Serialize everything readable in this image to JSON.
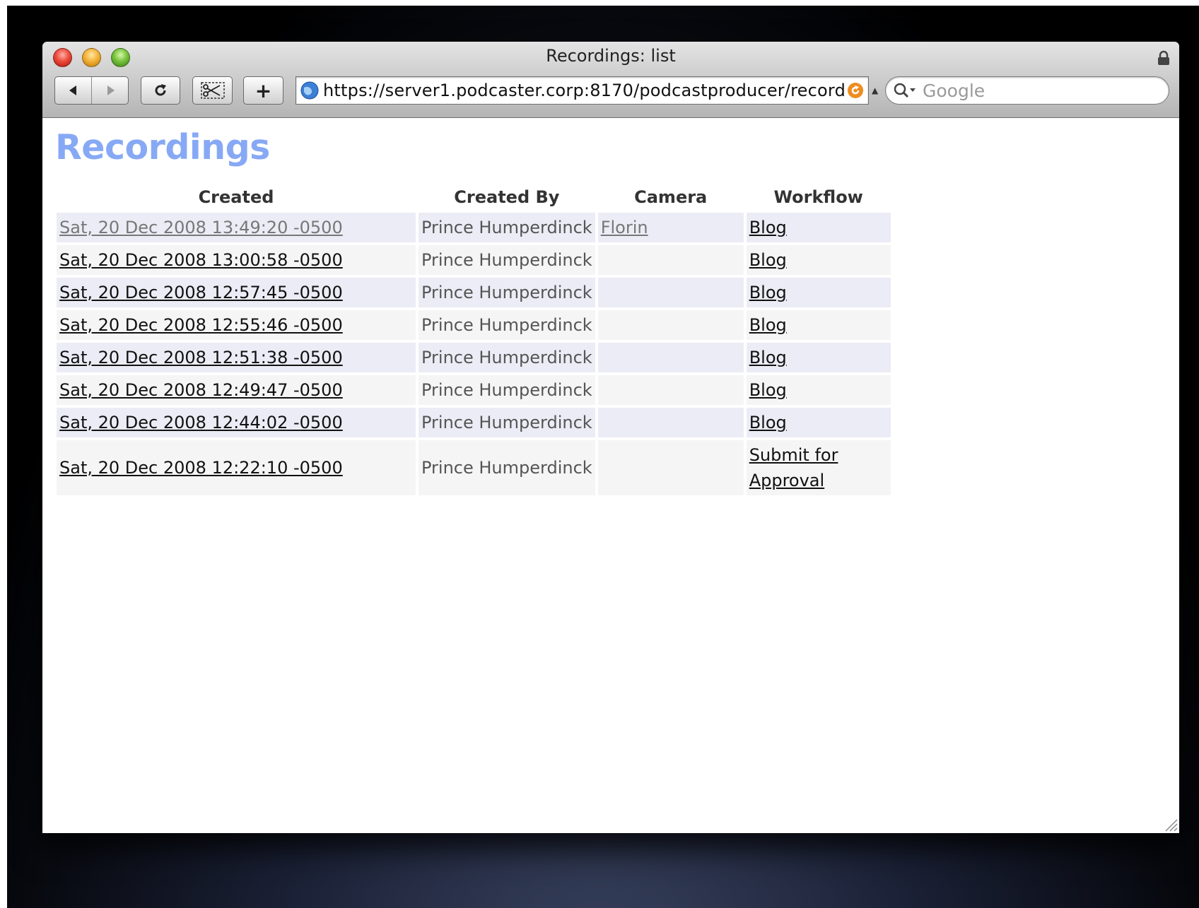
{
  "window": {
    "title": "Recordings: list"
  },
  "toolbar": {
    "url": "https://server1.podcaster.corp:8170/podcastproducer/record",
    "search_placeholder": "Google",
    "back_icon": "back-arrow-icon",
    "forward_icon": "forward-arrow-icon",
    "reload_icon": "reload-icon",
    "snip_icon": "snippet-icon",
    "add_label": "+"
  },
  "page": {
    "heading": "Recordings",
    "table": {
      "headers": [
        "Created",
        "Created By",
        "Camera",
        "Workflow"
      ],
      "rows": [
        {
          "created": "Sat, 20 Dec 2008 13:49:20 -0500",
          "created_by": "Prince Humperdinck",
          "camera": "Florin",
          "workflow": "Blog"
        },
        {
          "created": "Sat, 20 Dec 2008 13:00:58 -0500",
          "created_by": "Prince Humperdinck",
          "camera": "",
          "workflow": "Blog"
        },
        {
          "created": "Sat, 20 Dec 2008 12:57:45 -0500",
          "created_by": "Prince Humperdinck",
          "camera": "",
          "workflow": "Blog"
        },
        {
          "created": "Sat, 20 Dec 2008 12:55:46 -0500",
          "created_by": "Prince Humperdinck",
          "camera": "",
          "workflow": "Blog"
        },
        {
          "created": "Sat, 20 Dec 2008 12:51:38 -0500",
          "created_by": "Prince Humperdinck",
          "camera": "",
          "workflow": "Blog"
        },
        {
          "created": "Sat, 20 Dec 2008 12:49:47 -0500",
          "created_by": "Prince Humperdinck",
          "camera": "",
          "workflow": "Blog"
        },
        {
          "created": "Sat, 20 Dec 2008 12:44:02 -0500",
          "created_by": "Prince Humperdinck",
          "camera": "",
          "workflow": "Blog"
        },
        {
          "created": "Sat, 20 Dec 2008 12:22:10 -0500",
          "created_by": "Prince Humperdinck",
          "camera": "",
          "workflow": "Submit for Approval"
        }
      ]
    }
  },
  "colors": {
    "heading": "#87a9f5",
    "row_odd": "#ececf6",
    "row_even": "#f5f5f5"
  }
}
